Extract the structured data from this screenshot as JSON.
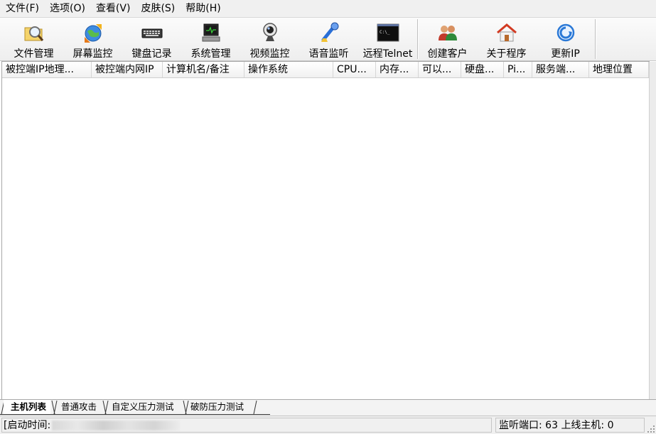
{
  "menu": [
    "文件(F)",
    "选项(O)",
    "查看(V)",
    "皮肤(S)",
    "帮助(H)"
  ],
  "toolbar": [
    {
      "label": "文件管理",
      "icon": "magnifier-folder-icon"
    },
    {
      "label": "屏幕监控",
      "icon": "globe-arrows-icon"
    },
    {
      "label": "键盘记录",
      "icon": "keyboard-icon"
    },
    {
      "label": "系统管理",
      "icon": "computer-monitor-icon"
    },
    {
      "label": "视频监控",
      "icon": "webcam-icon"
    },
    {
      "label": "语音监听",
      "icon": "microphone-icon"
    },
    {
      "label": "远程Telnet",
      "icon": "terminal-icon"
    },
    {
      "label": "创建客户",
      "icon": "users-icon"
    },
    {
      "label": "关于程序",
      "icon": "home-icon"
    },
    {
      "label": "更新IP",
      "icon": "refresh-globe-icon"
    }
  ],
  "columns": [
    "被控端IP地理...",
    "被控端内网IP",
    "计算机名/备注",
    "操作系统",
    "CPU...",
    "内存...",
    "可以...",
    "硬盘...",
    "Pi...",
    "服务端...",
    "地理位置"
  ],
  "tabs": [
    "主机列表",
    "普通攻击",
    "自定义压力测试",
    "破防压力测试"
  ],
  "status": {
    "left": "[启动时间:",
    "right": "监听端口: 63",
    "right_tail": "上线主机: 0"
  },
  "colors": {
    "accent": "#2a6fd6",
    "toolbar_bg": "#f4f4f4"
  }
}
